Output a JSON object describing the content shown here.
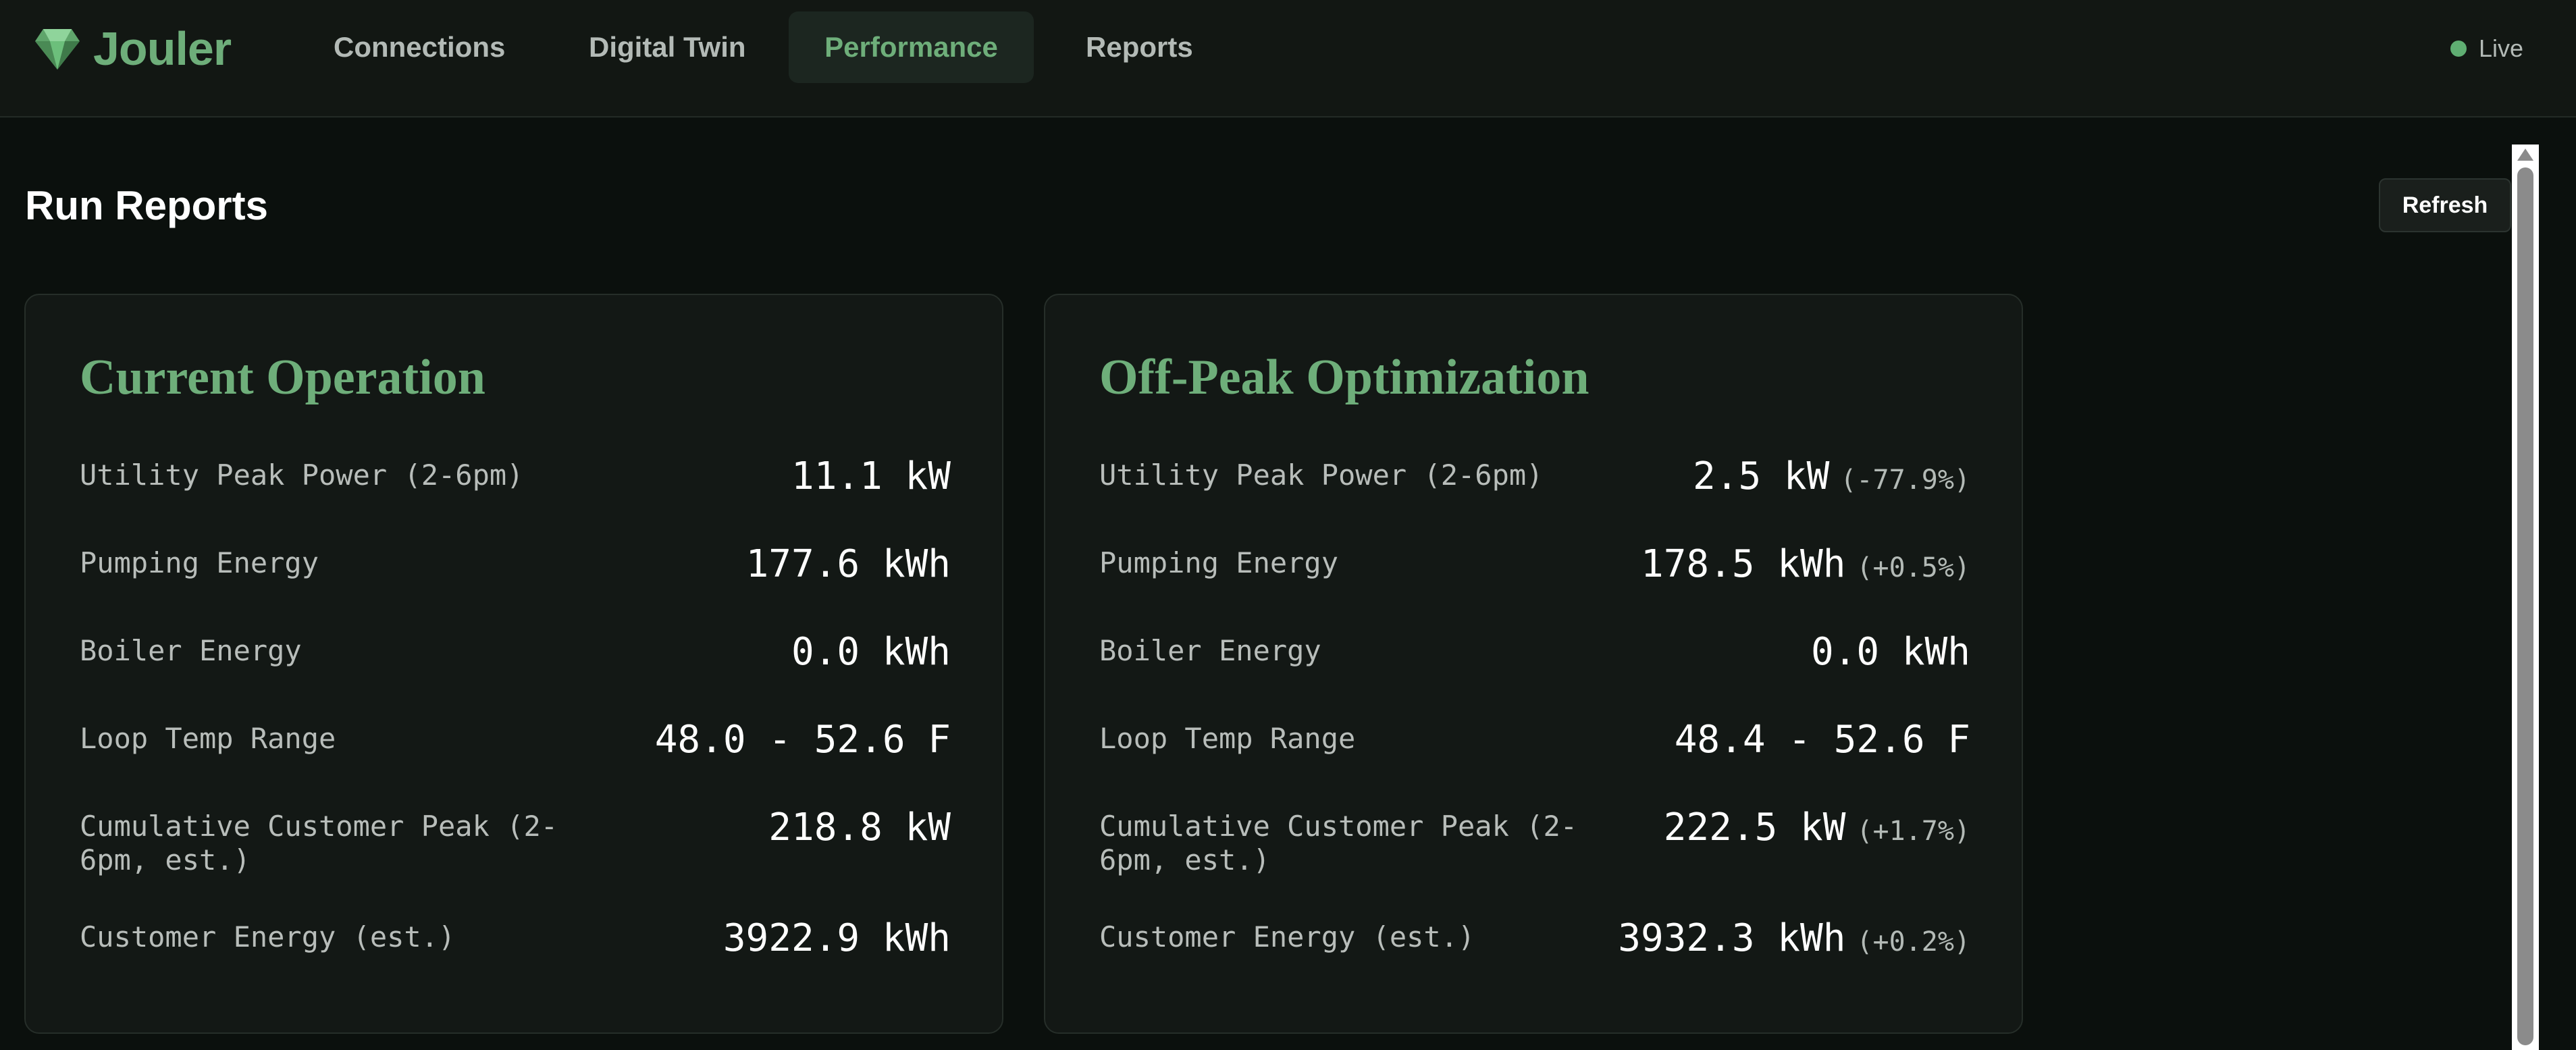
{
  "app": {
    "name": "Jouler",
    "logo_icon": "gem-icon",
    "accent_color": "#6eae7a"
  },
  "nav": {
    "tabs": [
      {
        "label": "Connections",
        "active": false
      },
      {
        "label": "Digital Twin",
        "active": false
      },
      {
        "label": "Performance",
        "active": true
      },
      {
        "label": "Reports",
        "active": false
      }
    ],
    "status": {
      "label": "Live",
      "icon": "status-dot-icon",
      "color": "#5fae72"
    }
  },
  "page": {
    "title": "Run Reports",
    "refresh_label": "Refresh"
  },
  "cards": [
    {
      "title": "Current Operation",
      "rows": [
        {
          "label": "Utility Peak Power (2-6pm)",
          "value": "11.1 kW",
          "delta": ""
        },
        {
          "label": "Pumping Energy",
          "value": "177.6 kWh",
          "delta": ""
        },
        {
          "label": "Boiler Energy",
          "value": "0.0 kWh",
          "delta": ""
        },
        {
          "label": "Loop Temp Range",
          "value": "48.0 - 52.6 F",
          "delta": ""
        },
        {
          "label": "Cumulative Customer Peak (2-6pm, est.)",
          "value": "218.8 kW",
          "delta": ""
        },
        {
          "label": "Customer Energy (est.)",
          "value": "3922.9 kWh",
          "delta": ""
        }
      ]
    },
    {
      "title": "Off-Peak Optimization",
      "rows": [
        {
          "label": "Utility Peak Power (2-6pm)",
          "value": "2.5 kW",
          "delta": "(-77.9%)"
        },
        {
          "label": "Pumping Energy",
          "value": "178.5 kWh",
          "delta": "(+0.5%)"
        },
        {
          "label": "Boiler Energy",
          "value": "0.0 kWh",
          "delta": ""
        },
        {
          "label": "Loop Temp Range",
          "value": "48.4 - 52.6 F",
          "delta": ""
        },
        {
          "label": "Cumulative Customer Peak (2-6pm, est.)",
          "value": "222.5 kW",
          "delta": "(+1.7%)"
        },
        {
          "label": "Customer Energy (est.)",
          "value": "3932.3 kWh",
          "delta": "(+0.2%)"
        }
      ]
    }
  ]
}
